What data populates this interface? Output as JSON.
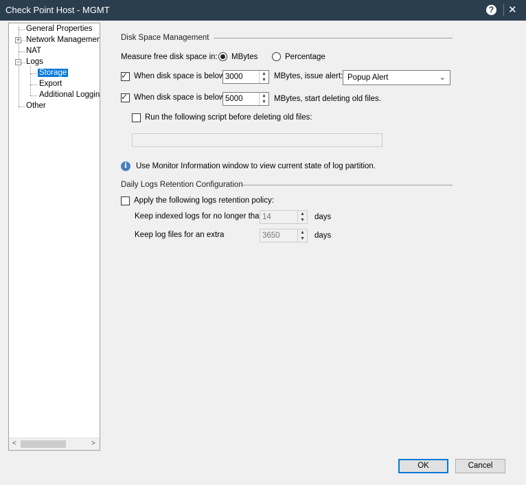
{
  "window": {
    "title": "Check Point Host - MGMT",
    "help_icon": "?",
    "close_icon": "✕"
  },
  "tree": {
    "items": [
      {
        "label": "General Properties"
      },
      {
        "label": "Network Management"
      },
      {
        "label": "NAT"
      },
      {
        "label": "Logs"
      },
      {
        "label": "Storage"
      },
      {
        "label": "Export"
      },
      {
        "label": "Additional Logging"
      },
      {
        "label": "Other"
      }
    ],
    "selected": "Storage",
    "expand_plus": "+",
    "expand_minus": "−",
    "scroll_left": "<",
    "scroll_right": ">"
  },
  "disk": {
    "section_title": "Disk Space Management",
    "measure_label": "Measure free disk space in:",
    "radio_mbytes": "MBytes",
    "radio_percentage": "Percentage",
    "measure_selected": "MBytes",
    "alert_checkbox_label": "When disk space is below",
    "alert_value": "3000",
    "alert_suffix": "MBytes, issue alert:",
    "alert_type": "Popup Alert",
    "delete_checkbox_label": "When disk space is below",
    "delete_value": "5000",
    "delete_suffix": "MBytes, start deleting old files.",
    "script_checkbox_label": "Run the following script before deleting old files:",
    "script_value": "",
    "info_text": "Use Monitor Information window to view current state of log partition.",
    "info_icon_glyph": "i",
    "check_glyph": "✓"
  },
  "retention": {
    "section_title": "Daily Logs Retention Configuration",
    "policy_checkbox_label": "Apply the following logs retention policy:",
    "indexed_label": "Keep indexed logs for no longer than",
    "indexed_value": "14",
    "files_label": "Keep log files for an extra",
    "files_value": "3650",
    "days": "days"
  },
  "buttons": {
    "ok": "OK",
    "cancel": "Cancel"
  },
  "colors": {
    "titlebar": "#2b3e50",
    "selection": "#0078d7"
  }
}
